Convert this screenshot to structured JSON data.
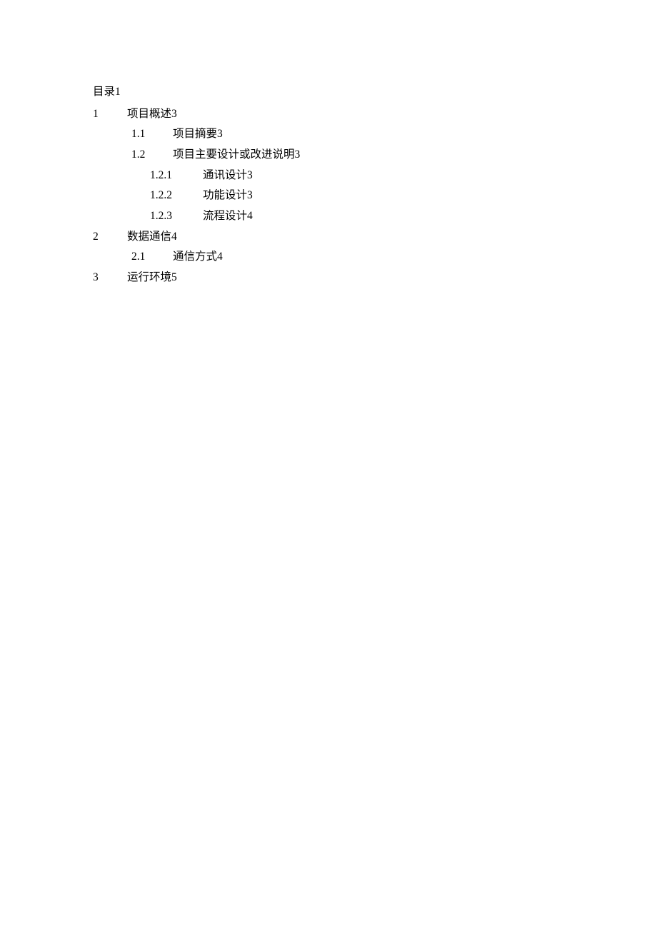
{
  "toc": {
    "title": "目录1",
    "entries": [
      {
        "level": 1,
        "num": "1",
        "title": "项目概述3"
      },
      {
        "level": 2,
        "num": "1.1",
        "title": "项目摘要3"
      },
      {
        "level": 2,
        "num": "1.2",
        "title": "项目主要设计或改进说明3"
      },
      {
        "level": 3,
        "num": "1.2.1",
        "title": "通讯设计3"
      },
      {
        "level": 3,
        "num": "1.2.2",
        "title": "功能设计3"
      },
      {
        "level": 3,
        "num": "1.2.3",
        "title": "流程设计4"
      },
      {
        "level": 1,
        "num": "2",
        "title": "数据通信4"
      },
      {
        "level": 2,
        "num": "2.1",
        "title": "通信方式4"
      },
      {
        "level": 1,
        "num": "3",
        "title": "运行环境5"
      }
    ]
  }
}
